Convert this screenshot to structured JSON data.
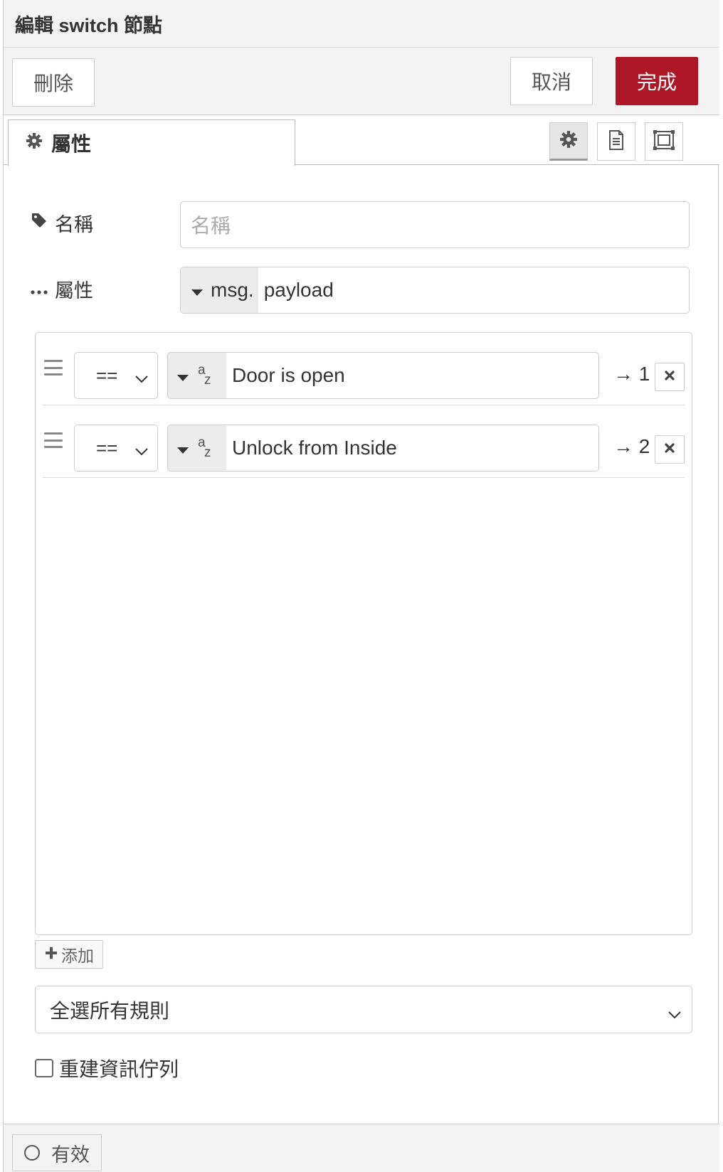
{
  "header": {
    "title": "編輯 switch 節點"
  },
  "toolbar": {
    "delete_label": "刪除",
    "cancel_label": "取消",
    "done_label": "完成"
  },
  "tabs": {
    "properties_label": "屬性"
  },
  "form": {
    "name": {
      "label": "名稱",
      "placeholder": "名稱"
    },
    "property": {
      "label": "屬性",
      "prefix": "msg.",
      "value": "payload"
    }
  },
  "rules": [
    {
      "operator": "==",
      "value": "Door is open",
      "output": "→ 1"
    },
    {
      "operator": "==",
      "value": "Unlock from Inside",
      "output": "→ 2"
    }
  ],
  "type_icon": {
    "top": "a",
    "bottom": "z"
  },
  "add_label": "添加",
  "check_mode": {
    "selected": "全選所有規則"
  },
  "repair": {
    "label": "重建資訊佇列"
  },
  "footer": {
    "enable_label": "有效"
  },
  "colors": {
    "primary": "#ad1625",
    "panel_bg": "#f3f3f3",
    "border": "#cccccc"
  }
}
